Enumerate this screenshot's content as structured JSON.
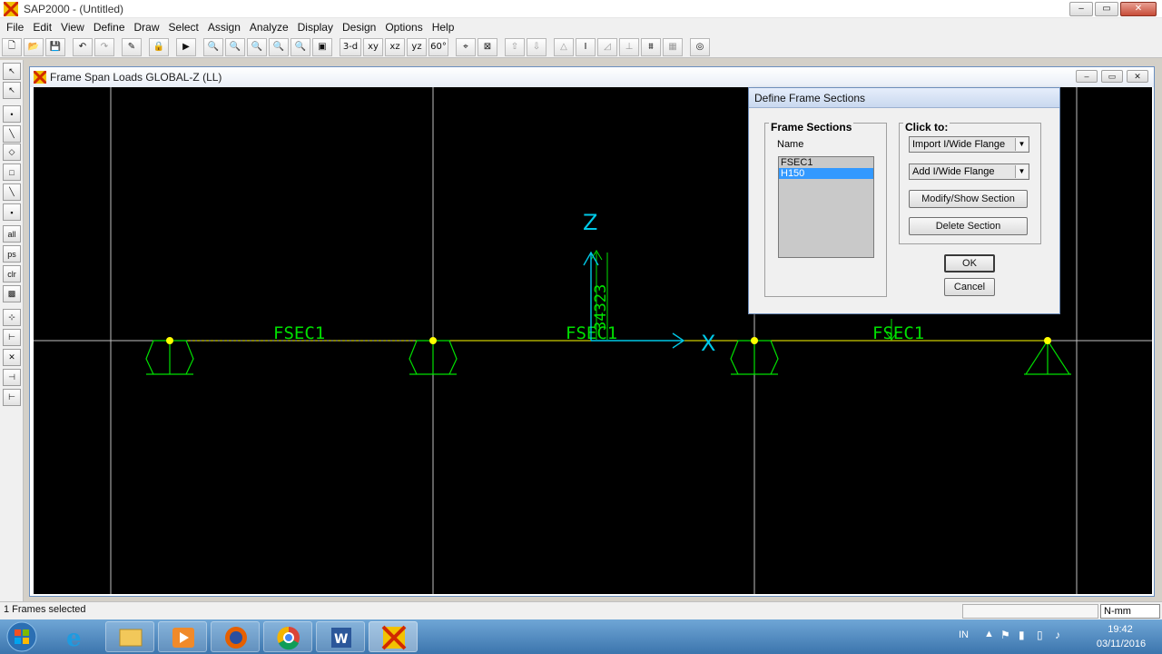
{
  "app": {
    "title": "SAP2000 - (Untitled)"
  },
  "menu": [
    "File",
    "Edit",
    "View",
    "Define",
    "Draw",
    "Select",
    "Assign",
    "Analyze",
    "Display",
    "Design",
    "Options",
    "Help"
  ],
  "toolbar": {
    "view_3d": "3-d",
    "view_xy": "xy",
    "view_xz": "xz",
    "view_yz": "yz",
    "view_60": "60°"
  },
  "left_toolbar": {
    "all_label": "all",
    "ps_label": "ps",
    "clr_label": "clr"
  },
  "mdi": {
    "title": "Frame Span Loads GLOBAL-Z (LL)"
  },
  "canvas": {
    "axis_z": "Z",
    "axis_x": "X",
    "section_labels": [
      "FSEC1",
      "FSEC1",
      "FSEC1"
    ],
    "load_value": "34323",
    "colors": {
      "background": "#000000",
      "frame": "#ffff00",
      "restraint": "#00e000",
      "axis": "#00c8e6",
      "grid": "#bfbfbf"
    }
  },
  "dialog": {
    "title": "Define Frame Sections",
    "frame_sections_label": "Frame Sections",
    "name_label": "Name",
    "sections": [
      "FSEC1",
      "H150"
    ],
    "selected_section": "H150",
    "click_to_label": "Click to:",
    "import_combo": "Import I/Wide Flange",
    "add_combo": "Add I/Wide Flange",
    "modify_button": "Modify/Show Section",
    "delete_button": "Delete Section",
    "ok_button": "OK",
    "cancel_button": "Cancel"
  },
  "status": {
    "text": "1 Frames selected",
    "units": "N-mm"
  },
  "taskbar": {
    "lang": "IN",
    "time": "19:42",
    "date": "03/11/2016"
  }
}
